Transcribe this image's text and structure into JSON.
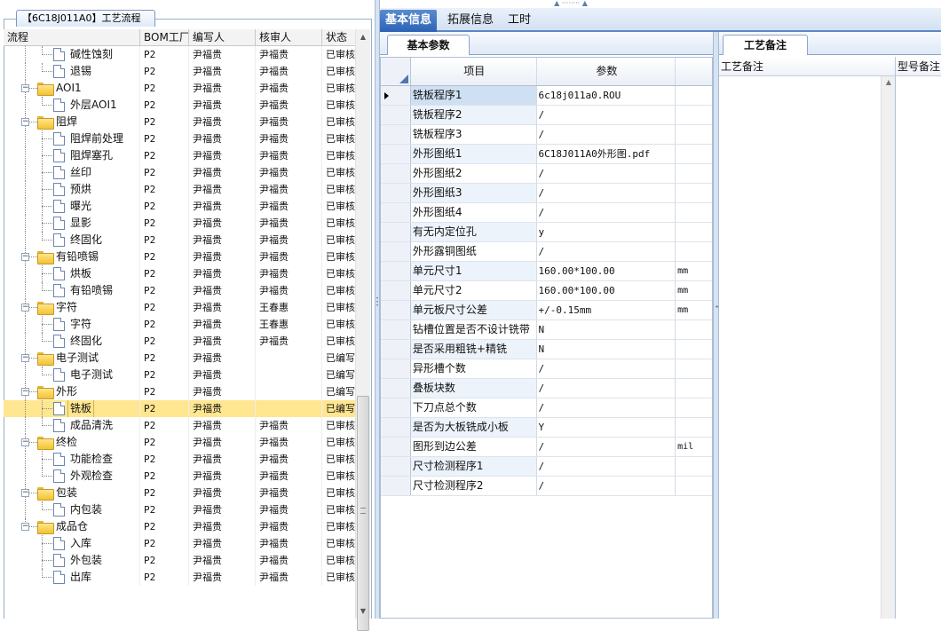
{
  "left_panel": {
    "group_title": "【6C18J011A0】工艺流程",
    "columns": [
      "流程",
      "BOM工厂",
      "编写人",
      "核审人",
      "状态"
    ],
    "rows": [
      {
        "kind": "leaf",
        "label": "碱性蚀刻",
        "bom": "P2",
        "writer": "尹福贵",
        "reviewer": "尹福贵",
        "status": "已审核",
        "last": true
      },
      {
        "kind": "leaf",
        "label": "退锡",
        "bom": "P2",
        "writer": "尹福贵",
        "reviewer": "尹福贵",
        "status": "已审核",
        "last": true
      },
      {
        "kind": "group",
        "label": "AOI1",
        "bom": "P2",
        "writer": "尹福贵",
        "reviewer": "尹福贵",
        "status": "已审核"
      },
      {
        "kind": "leaf",
        "label": "外层AOI1",
        "bom": "P2",
        "writer": "尹福贵",
        "reviewer": "尹福贵",
        "status": "已审核",
        "last": true
      },
      {
        "kind": "group",
        "label": "阻焊",
        "bom": "P2",
        "writer": "尹福贵",
        "reviewer": "尹福贵",
        "status": "已审核"
      },
      {
        "kind": "leaf",
        "label": "阻焊前处理",
        "bom": "P2",
        "writer": "尹福贵",
        "reviewer": "尹福贵",
        "status": "已审核"
      },
      {
        "kind": "leaf",
        "label": "阻焊塞孔",
        "bom": "P2",
        "writer": "尹福贵",
        "reviewer": "尹福贵",
        "status": "已审核"
      },
      {
        "kind": "leaf",
        "label": "丝印",
        "bom": "P2",
        "writer": "尹福贵",
        "reviewer": "尹福贵",
        "status": "已审核"
      },
      {
        "kind": "leaf",
        "label": "预烘",
        "bom": "P2",
        "writer": "尹福贵",
        "reviewer": "尹福贵",
        "status": "已审核"
      },
      {
        "kind": "leaf",
        "label": "曝光",
        "bom": "P2",
        "writer": "尹福贵",
        "reviewer": "尹福贵",
        "status": "已审核"
      },
      {
        "kind": "leaf",
        "label": "显影",
        "bom": "P2",
        "writer": "尹福贵",
        "reviewer": "尹福贵",
        "status": "已审核"
      },
      {
        "kind": "leaf",
        "label": "终固化",
        "bom": "P2",
        "writer": "尹福贵",
        "reviewer": "尹福贵",
        "status": "已审核",
        "last": true
      },
      {
        "kind": "group",
        "label": "有铅喷锡",
        "bom": "P2",
        "writer": "尹福贵",
        "reviewer": "尹福贵",
        "status": "已审核"
      },
      {
        "kind": "leaf",
        "label": "烘板",
        "bom": "P2",
        "writer": "尹福贵",
        "reviewer": "尹福贵",
        "status": "已审核"
      },
      {
        "kind": "leaf",
        "label": "有铅喷锡",
        "bom": "P2",
        "writer": "尹福贵",
        "reviewer": "尹福贵",
        "status": "已审核",
        "last": true
      },
      {
        "kind": "group",
        "label": "字符",
        "bom": "P2",
        "writer": "尹福贵",
        "reviewer": "王春惠",
        "status": "已审核"
      },
      {
        "kind": "leaf",
        "label": "字符",
        "bom": "P2",
        "writer": "尹福贵",
        "reviewer": "王春惠",
        "status": "已审核"
      },
      {
        "kind": "leaf",
        "label": "终固化",
        "bom": "P2",
        "writer": "尹福贵",
        "reviewer": "尹福贵",
        "status": "已审核",
        "last": true
      },
      {
        "kind": "group",
        "label": "电子测试",
        "bom": "P2",
        "writer": "尹福贵",
        "reviewer": "",
        "status": "已编写"
      },
      {
        "kind": "leaf",
        "label": "电子测试",
        "bom": "P2",
        "writer": "尹福贵",
        "reviewer": "",
        "status": "已编写",
        "last": true
      },
      {
        "kind": "group",
        "label": "外形",
        "bom": "P2",
        "writer": "尹福贵",
        "reviewer": "",
        "status": "已编写"
      },
      {
        "kind": "leaf",
        "label": "铣板",
        "bom": "P2",
        "writer": "尹福贵",
        "reviewer": "",
        "status": "已编写",
        "selected": true
      },
      {
        "kind": "leaf",
        "label": "成品清洗",
        "bom": "P2",
        "writer": "尹福贵",
        "reviewer": "尹福贵",
        "status": "已审核",
        "last": true
      },
      {
        "kind": "group",
        "label": "终检",
        "bom": "P2",
        "writer": "尹福贵",
        "reviewer": "尹福贵",
        "status": "已审核"
      },
      {
        "kind": "leaf",
        "label": "功能检查",
        "bom": "P2",
        "writer": "尹福贵",
        "reviewer": "尹福贵",
        "status": "已审核"
      },
      {
        "kind": "leaf",
        "label": "外观检查",
        "bom": "P2",
        "writer": "尹福贵",
        "reviewer": "尹福贵",
        "status": "已审核",
        "last": true
      },
      {
        "kind": "group",
        "label": "包装",
        "bom": "P2",
        "writer": "尹福贵",
        "reviewer": "尹福贵",
        "status": "已审核"
      },
      {
        "kind": "leaf",
        "label": "内包装",
        "bom": "P2",
        "writer": "尹福贵",
        "reviewer": "尹福贵",
        "status": "已审核",
        "last": true
      },
      {
        "kind": "group",
        "label": "成品仓",
        "bom": "P2",
        "writer": "尹福贵",
        "reviewer": "尹福贵",
        "status": "已审核",
        "lastGroup": true
      },
      {
        "kind": "leaf",
        "label": "入库",
        "bom": "P2",
        "writer": "尹福贵",
        "reviewer": "尹福贵",
        "status": "已审核"
      },
      {
        "kind": "leaf",
        "label": "外包装",
        "bom": "P2",
        "writer": "尹福贵",
        "reviewer": "尹福贵",
        "status": "已审核"
      },
      {
        "kind": "leaf",
        "label": "出库",
        "bom": "P2",
        "writer": "尹福贵",
        "reviewer": "尹福贵",
        "status": "已审核",
        "last": true
      }
    ]
  },
  "main_tabs": [
    "基本信息",
    "拓展信息",
    "工时"
  ],
  "basic_params": {
    "tab": "基本参数",
    "columns": [
      "项目",
      "参数"
    ],
    "rows": [
      {
        "item": "铣板程序1",
        "value": "6c18j011a0.ROU",
        "unit": ""
      },
      {
        "item": "铣板程序2",
        "value": "/",
        "unit": ""
      },
      {
        "item": "铣板程序3",
        "value": "/",
        "unit": ""
      },
      {
        "item": "外形图纸1",
        "value": "6C18J011A0外形图.pdf",
        "unit": ""
      },
      {
        "item": "外形图纸2",
        "value": "/",
        "unit": ""
      },
      {
        "item": "外形图纸3",
        "value": "/",
        "unit": ""
      },
      {
        "item": "外形图纸4",
        "value": "/",
        "unit": ""
      },
      {
        "item": "有无内定位孔",
        "value": "y",
        "unit": ""
      },
      {
        "item": "外形露铜图纸",
        "value": "/",
        "unit": ""
      },
      {
        "item": "单元尺寸1",
        "value": "160.00*100.00",
        "unit": "mm"
      },
      {
        "item": "单元尺寸2",
        "value": "160.00*100.00",
        "unit": "mm"
      },
      {
        "item": "单元板尺寸公差",
        "value": "+/-0.15mm",
        "unit": "mm"
      },
      {
        "item": "钻槽位置是否不设计铣带",
        "value": "N",
        "unit": ""
      },
      {
        "item": "是否采用粗铣+精铣",
        "value": "N",
        "unit": ""
      },
      {
        "item": "异形槽个数",
        "value": "/",
        "unit": ""
      },
      {
        "item": "叠板块数",
        "value": "/",
        "unit": ""
      },
      {
        "item": "下刀点总个数",
        "value": "/",
        "unit": ""
      },
      {
        "item": "是否为大板铣成小板",
        "value": "Y",
        "unit": ""
      },
      {
        "item": "图形到边公差",
        "value": "/",
        "unit": "mil"
      },
      {
        "item": "尺寸检测程序1",
        "value": "/",
        "unit": ""
      },
      {
        "item": "尺寸检测程序2",
        "value": "/",
        "unit": ""
      }
    ]
  },
  "notes_panel": {
    "tab": "工艺备注",
    "columns": [
      "工艺备注",
      "型号备注"
    ]
  }
}
